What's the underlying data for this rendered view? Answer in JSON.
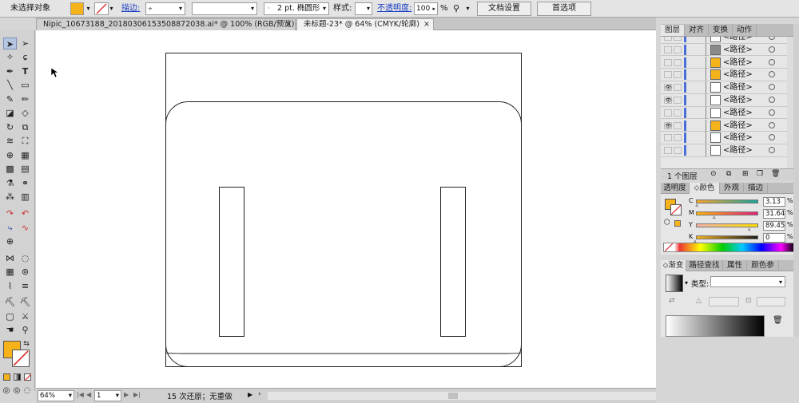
{
  "control_bar": {
    "selection_label": "未选择对象",
    "stroke_link": "描边:",
    "stroke_profile": "2 pt. 椭圆形",
    "style_label": "样式:",
    "opacity_link": "不透明度:",
    "opacity_value": "100",
    "opacity_unit": "%",
    "doc_setup_btn": "文档设置",
    "prefs_btn": "首选项",
    "fill_color": "#f5b21b"
  },
  "tabs": [
    {
      "label": "Nipic_10673188_20180306153508872038.ai* @ 100% (RGB/预览)",
      "close": "×"
    },
    {
      "label": "未标题-23* @ 64% (CMYK/轮廓)",
      "close": "×"
    }
  ],
  "status": {
    "zoom": "64%",
    "artboard": "1",
    "history": "15 次还原；无重做"
  },
  "layers_panel": {
    "tabs": [
      "图层",
      "对齐",
      "变换",
      "动作"
    ],
    "rows": [
      {
        "label": "<路径>",
        "eye": false
      },
      {
        "label": "<路径>",
        "eye": false
      },
      {
        "label": "<路径>",
        "eye": false
      },
      {
        "label": "<路径>",
        "eye": false
      },
      {
        "label": "<路径>",
        "eye": true
      },
      {
        "label": "<路径>",
        "eye": true
      },
      {
        "label": "<路径>",
        "eye": false
      },
      {
        "label": "<路径>",
        "eye": true
      },
      {
        "label": "<路径>",
        "eye": false
      },
      {
        "label": "<路径>",
        "eye": false
      }
    ],
    "count": "1 个图层"
  },
  "color_panel": {
    "tabs": [
      "透明度",
      "颜色",
      "外观",
      "描边"
    ],
    "channels": [
      {
        "name": "C",
        "value": "3.13",
        "fraction": 0.0313
      },
      {
        "name": "M",
        "value": "31.64",
        "fraction": 0.3164
      },
      {
        "name": "Y",
        "value": "89.45",
        "fraction": 0.8945
      },
      {
        "name": "K",
        "value": "0",
        "fraction": 0
      }
    ],
    "swatch": "#f5b21b"
  },
  "gradient_panel": {
    "tabs": [
      "渐变",
      "路径查找",
      "属性",
      "颜色参"
    ],
    "type_label": "类型:"
  }
}
